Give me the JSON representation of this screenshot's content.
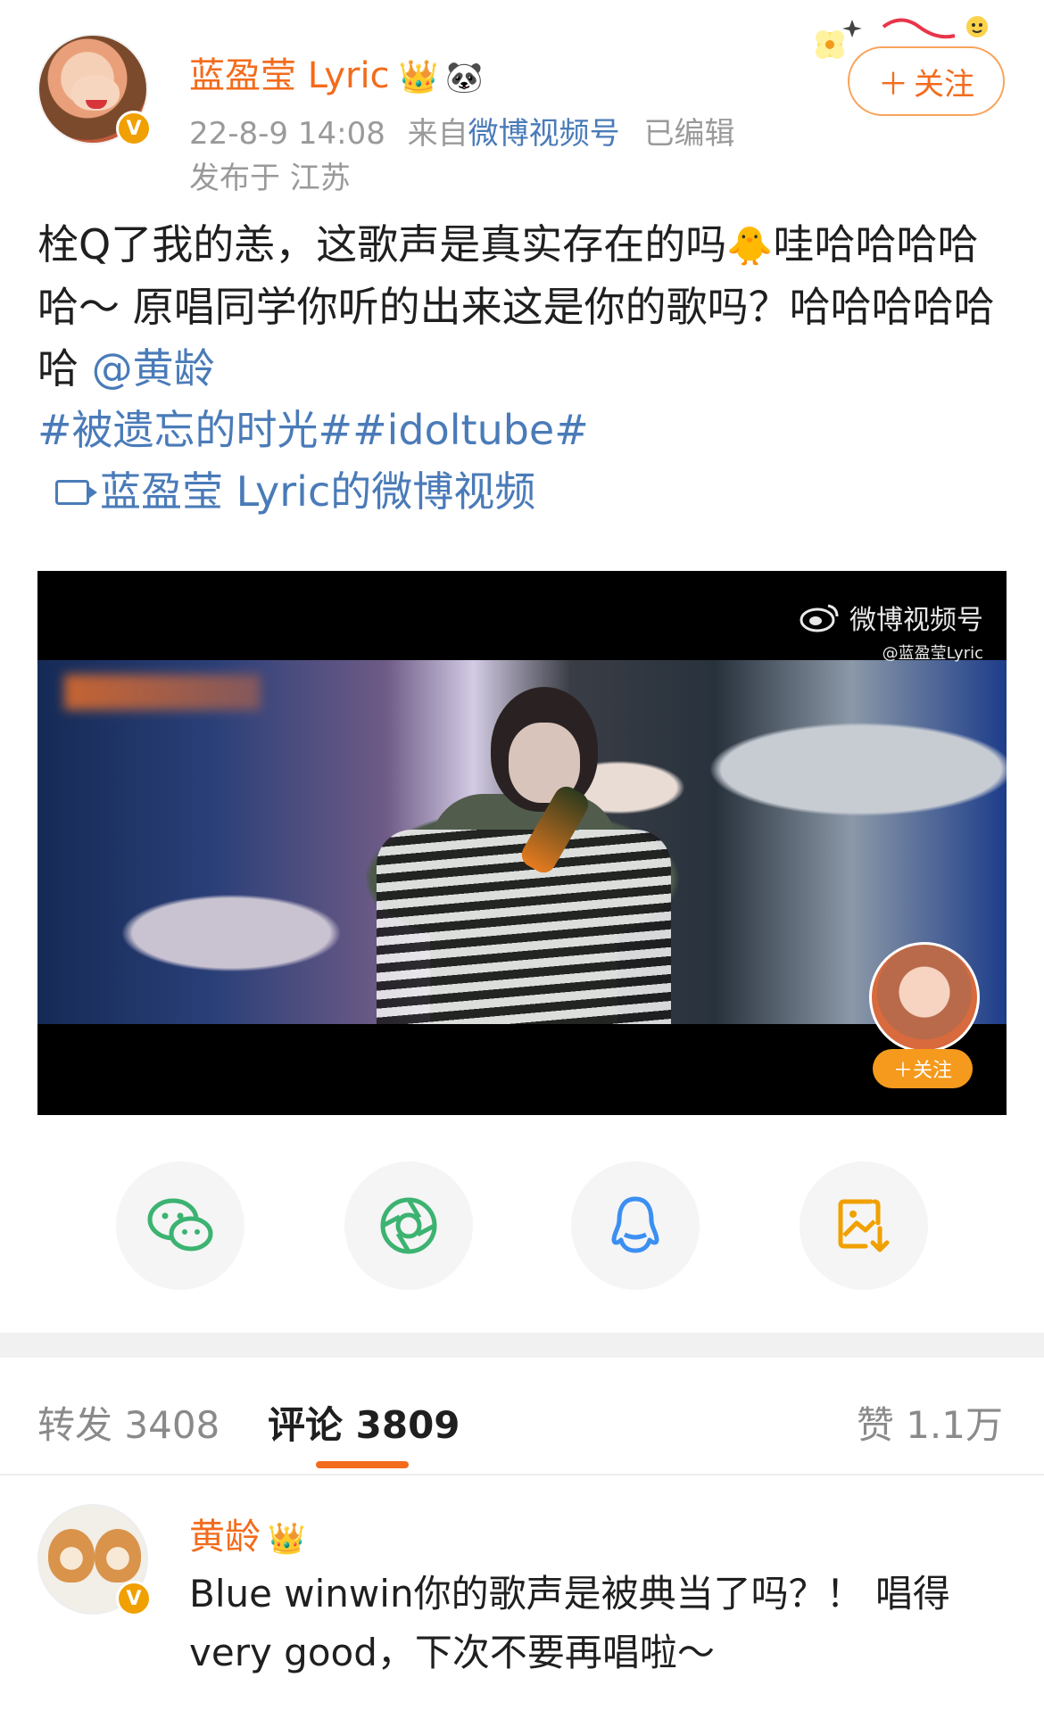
{
  "post": {
    "username": "蓝盈莹 Lyric",
    "crown_emoji": "👑",
    "panda_emoji": "🐼",
    "verified_mark": "V",
    "timestamp": "22-8-9 14:08",
    "source_prefix": "来自",
    "source_name": "微博视频号",
    "edited": "已编辑",
    "location": "发布于 江苏",
    "follow_plus": "＋",
    "follow_label": "关注",
    "text_line": "栓Q了我的恙，这歌声是真实存在的吗",
    "chick_emoji": "🐥",
    "text_after": "哇哈哈哈哈哈～ 原唱同学你听的出来这是你的歌吗？哈哈哈哈哈哈",
    "mention": "@黄龄",
    "hashtags": "#被遗忘的时光##idoltube#",
    "video_link": "蓝盈莹 Lyric的微博视频"
  },
  "video": {
    "watermark_title": "微博视频号",
    "watermark_handle": "@蓝盈莹Lyric",
    "follow_label": "＋关注"
  },
  "share": {
    "icons": [
      "wechat-icon",
      "moments-icon",
      "qq-icon",
      "save-image-icon"
    ]
  },
  "tabs": {
    "repost_label": "转发",
    "repost_count": "3408",
    "comments_label": "评论",
    "comments_count": "3809",
    "likes_label": "赞",
    "likes_count": "1.1万"
  },
  "comment": {
    "username": "黄龄",
    "crown_emoji": "👑",
    "verified_mark": "V",
    "text": "Blue winwin你的歌声是被典当了吗？！ 唱得very good，下次不要再唱啦～"
  },
  "colors": {
    "accent": "#f36b1c",
    "link": "#4a7bb8",
    "wechat": "#3cb371",
    "moments": "#3cb371",
    "qq": "#3b8ff2",
    "save": "#f0a000"
  }
}
